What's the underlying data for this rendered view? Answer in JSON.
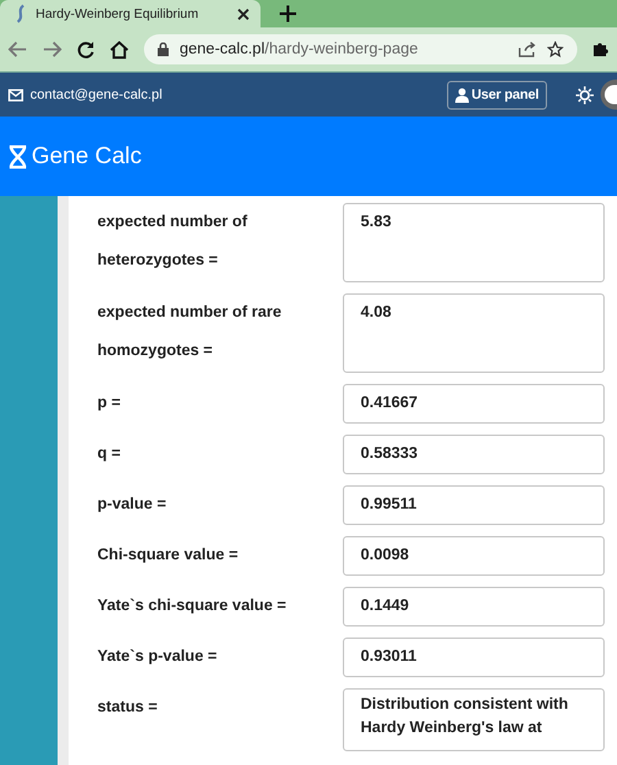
{
  "browser": {
    "tab_title": "Hardy-Weinberg Equilibrium",
    "url_host": "gene-calc.pl",
    "url_path": "/hardy-weinberg-page"
  },
  "top_bar": {
    "email": "contact@gene-calc.pl",
    "user_button": "User panel",
    "dark_mode": false
  },
  "header": {
    "brand": "Gene Calc"
  },
  "results": [
    {
      "label": "expected number of heterozygotes =",
      "value": "5.83",
      "kind": "tall"
    },
    {
      "label": "expected number of rare homozygotes =",
      "value": "4.08",
      "kind": "tall"
    },
    {
      "label": "p =",
      "value": "0.41667",
      "kind": "short"
    },
    {
      "label": "q =",
      "value": "0.58333",
      "kind": "short"
    },
    {
      "label": "p-value =",
      "value": "0.99511",
      "kind": "short"
    },
    {
      "label": "Chi-square value =",
      "value": "0.0098",
      "kind": "short"
    },
    {
      "label": "Yate`s chi-square value =",
      "value": "0.1449",
      "kind": "short"
    },
    {
      "label": "Yate`s p-value =",
      "value": "0.93011",
      "kind": "short"
    },
    {
      "label": "status =",
      "value": "Distribution consistent with Hardy Weinberg's law at",
      "kind": "text"
    }
  ]
}
